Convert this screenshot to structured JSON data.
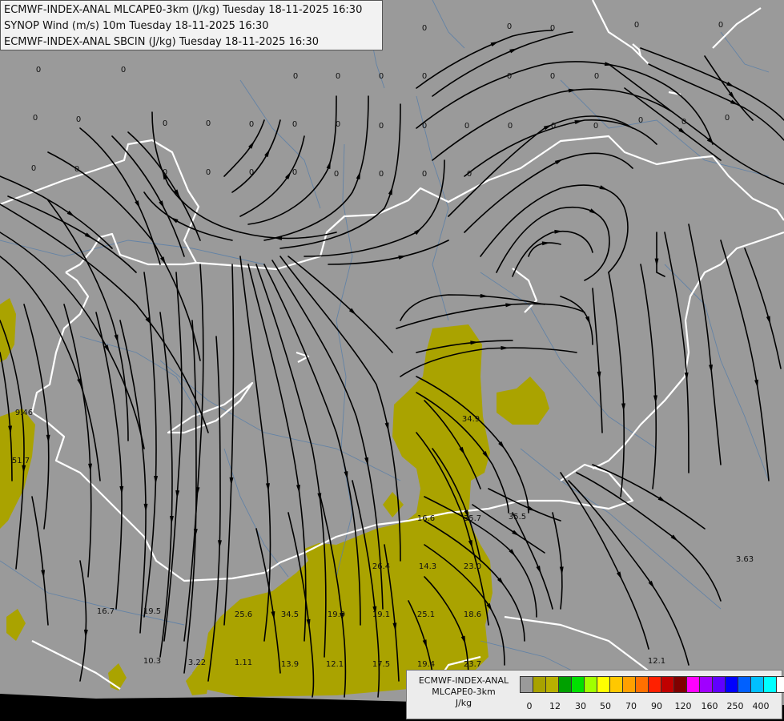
{
  "header": {
    "lines": [
      "ECMWF-INDEX-ANAL MLCAPE0-3km (J/kg) Tuesday 18-11-2025 16:30",
      "SYNOP Wind (m/s) 10m Tuesday 18-11-2025 16:30",
      "ECMWF-INDEX-ANAL SBCIN (J/kg) Tuesday 18-11-2025 16:30"
    ]
  },
  "legend": {
    "title_lines": [
      "ECMWF-INDEX-ANAL",
      "MLCAPE0-3km",
      "J/kg"
    ],
    "tick_labels": [
      "0",
      "12",
      "30",
      "50",
      "70",
      "90",
      "120",
      "160",
      "250",
      "400"
    ],
    "colors": [
      "#9a9a9a",
      "#a8a200",
      "#b8b000",
      "#00a000",
      "#00e000",
      "#a0ff00",
      "#ffff00",
      "#ffc800",
      "#ffa000",
      "#ff7000",
      "#ff2000",
      "#c00000",
      "#800000",
      "#ff00ff",
      "#a000ff",
      "#6000ff",
      "#0000ff",
      "#0060ff",
      "#00c0ff",
      "#00ffff",
      "#ffffff"
    ]
  },
  "map": {
    "background_color": "#9a9a9a",
    "cape_color": "#aaa300",
    "border_color": "#ffffff",
    "streamline_color": "#000000",
    "value_labels": [
      "0",
      "0",
      "0",
      "0",
      "0",
      "0",
      "0",
      "0",
      "0",
      "0",
      "0",
      "0",
      "0",
      "0",
      "0",
      "0",
      "0",
      "0",
      "0",
      "0",
      "0",
      "0",
      "0",
      "0",
      "0",
      "0",
      "0",
      "0",
      "0",
      "0",
      "0",
      "0",
      "0",
      "0",
      "0",
      "0",
      "0",
      "0",
      "0",
      "0",
      "9.46",
      "51.7",
      "16.7",
      "19.5",
      "10.3",
      "3.22",
      "1.11",
      "25.6",
      "34.5",
      "13.9",
      "19.9",
      "12.1",
      "26.4",
      "19.1",
      "17.5",
      "14.3",
      "25.1",
      "19.4",
      "16.6",
      "35.7",
      "23.0",
      "18.6",
      "23.7",
      "34.9",
      "35.5",
      "12.1",
      "3.63"
    ]
  }
}
